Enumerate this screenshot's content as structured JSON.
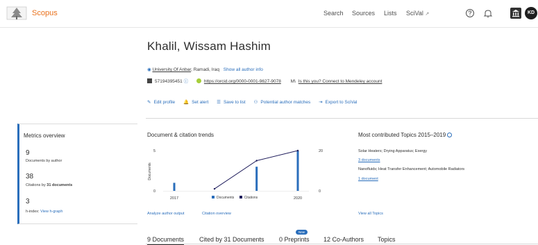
{
  "header": {
    "brand": "Scopus",
    "nav": [
      {
        "label": "Search"
      },
      {
        "label": "Sources"
      },
      {
        "label": "Lists"
      },
      {
        "label": "SciVal",
        "ext": "↗"
      }
    ],
    "avatar_initials": "KD"
  },
  "author": {
    "name": "Khalil, Wissam Hashim",
    "affiliation": "University Of Anbar",
    "location": ", Ramadi, Iraq",
    "show_all": "Show all author info",
    "scopus_id": "57194395451",
    "orcid": "https://orcid.org/0000-0001-9627-9078",
    "mendeley_prefix": "M\\",
    "mendeley": "Is this you? Connect to Mendeley account"
  },
  "actions": [
    {
      "icon": "✎",
      "label": "Edit profile"
    },
    {
      "icon": "🔔",
      "label": "Set alert"
    },
    {
      "icon": "☰",
      "label": "Save to list"
    },
    {
      "icon": "⚇",
      "label": "Potential author matches"
    },
    {
      "icon": "⇥",
      "label": "Export to SciVal"
    }
  ],
  "metrics": {
    "title": "Metrics overview",
    "documents_value": "9",
    "documents_label": "Documents by author",
    "citations_value": "38",
    "citations_label_prefix": "Citations by ",
    "citations_label_bold": "31 documents",
    "hindex_value": "3",
    "hindex_label": "h-index: ",
    "hindex_link": "View h-graph"
  },
  "trends": {
    "title": "Document & citation trends",
    "legend_documents": "Documents",
    "legend_citations": "Citations",
    "analyze_link": "Analyze author output",
    "citation_link": "Citation overview"
  },
  "chart_data": {
    "type": "bar",
    "categories": [
      "2017",
      "2018",
      "2019",
      "2020"
    ],
    "x_tick_labels": [
      "2017",
      "2020"
    ],
    "series": [
      {
        "name": "Documents",
        "type": "bar",
        "values": [
          1,
          0,
          3,
          5
        ],
        "color": "#2a6ebb",
        "axis": "left"
      },
      {
        "name": "Citations",
        "type": "line",
        "values": [
          1,
          0,
          15,
          20
        ],
        "color": "#1f1d5c",
        "axis": "right"
      }
    ],
    "ylabel": "Documents",
    "y2label": "Citations",
    "ylim": [
      0,
      5
    ],
    "y2lim": [
      0,
      20
    ],
    "yticks": [
      0,
      5
    ],
    "y2ticks": [
      0,
      20
    ],
    "grid": false,
    "legend": "bottom"
  },
  "topics": {
    "title": "Most contributed Topics 2015–2019",
    "items": [
      {
        "name": "Solar Heaters; Drying Apparatus; Exergy",
        "count": "3 documents"
      },
      {
        "name": "Nanofluids; Heat Transfer Enhancement; Automobile Radiators",
        "count": "1 document"
      }
    ],
    "view_all": "View all Topics"
  },
  "tabs": [
    {
      "label": "9 Documents",
      "active": true
    },
    {
      "label": "Cited by 31 Documents",
      "active": false
    },
    {
      "label": "0 Preprints",
      "active": false,
      "badge": "New"
    },
    {
      "label": "12 Co-Authors",
      "active": false
    },
    {
      "label": "Topics",
      "active": false
    }
  ],
  "colors": {
    "accent": "#2a6ebb",
    "brand": "#e9711c",
    "citations_line": "#1f1d5c",
    "orcid": "#a6ce39"
  }
}
